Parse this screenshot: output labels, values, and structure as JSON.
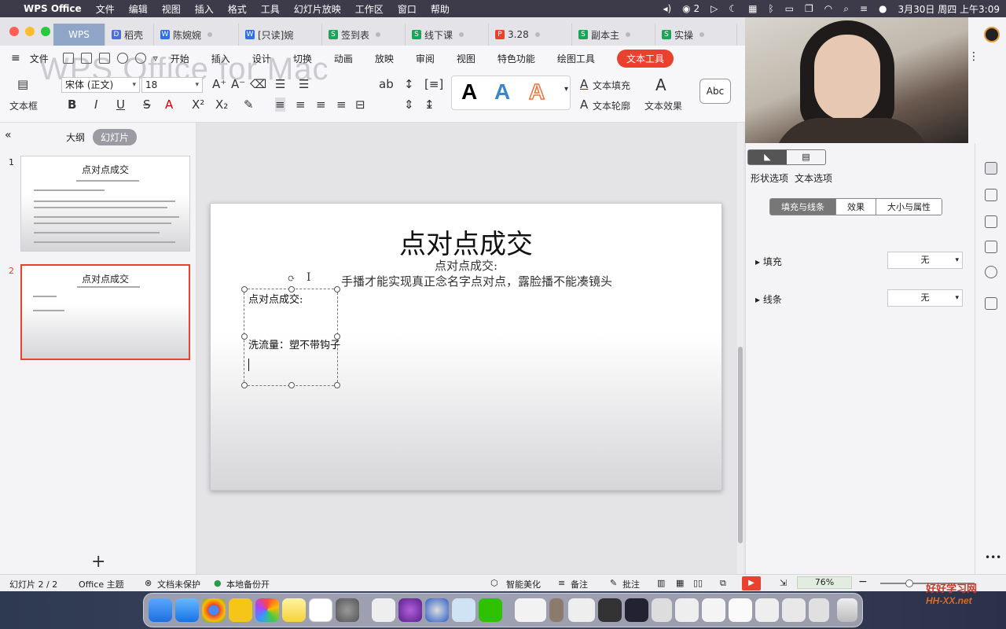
{
  "menubar": {
    "app": "WPS Office",
    "items": [
      "文件",
      "编辑",
      "视图",
      "插入",
      "格式",
      "工具",
      "幻灯片放映",
      "工作区",
      "窗口",
      "帮助"
    ],
    "wechat_badge": "2",
    "clock": "3月30日 周四 上午3:09"
  },
  "tabs": [
    {
      "label": "WPS",
      "color": "#8fa6c8"
    },
    {
      "label": "稻壳",
      "color": "#4a6fd6",
      "icon": "D"
    },
    {
      "label": "陈婉婉",
      "color": "#2f6fe6",
      "icon": "W"
    },
    {
      "label": "[只读]婉",
      "color": "#2f6fe6",
      "icon": "W"
    },
    {
      "label": "签到表",
      "color": "#1fa35a",
      "icon": "S"
    },
    {
      "label": "线下课",
      "color": "#1fa35a",
      "icon": "S"
    },
    {
      "label": "3.28",
      "color": "#e8412e",
      "icon": "P"
    },
    {
      "label": "副本主",
      "color": "#1fa35a",
      "icon": "S"
    },
    {
      "label": "实操",
      "color": "#1fa35a",
      "icon": "S"
    }
  ],
  "ribbon": {
    "file": "文件",
    "watermark": "WPS Office for Mac",
    "menus": [
      "开始",
      "插入",
      "设计",
      "切换",
      "动画",
      "放映",
      "审阅",
      "视图",
      "特色功能",
      "绘图工具"
    ],
    "active_menu": "文本工具",
    "textbox_label": "文本框",
    "font_name": "宋体 (正文)",
    "font_size": "18",
    "text_fill": "文本填充",
    "text_outline": "文本轮廓",
    "text_effect": "文本效果",
    "style_glyph": "A",
    "abc": "Abc"
  },
  "leftpanel": {
    "tab_outline": "大纲",
    "tab_slides": "幻灯片",
    "slides": [
      {
        "num": "1",
        "title": "点对点成交"
      },
      {
        "num": "2",
        "title": "点对点成交"
      }
    ],
    "add": "+"
  },
  "slide": {
    "title": "点对点成交",
    "subtitle1": "点对点成交:",
    "subtitle2": "手播才能实现真正念名字点对点，露脸播不能凑镜头",
    "textbox_line1": "点对点成交:",
    "textbox_line2": "洗流量：塑不带钩子"
  },
  "rightpanel": {
    "shape_options": "形状选项",
    "text_options": "文本选项",
    "subtabs": [
      "填充与线条",
      "效果",
      "大小与属性"
    ],
    "fill_label": "填充",
    "fill_value": "无",
    "line_label": "线条",
    "line_value": "无"
  },
  "statusbar": {
    "slide_index": "幻灯片 2 / 2",
    "theme": "Office 主题",
    "protect": "文档未保护",
    "backup": "本地备份开",
    "beautify": "智能美化",
    "notes": "备注",
    "comment": "批注",
    "zoom": "76%"
  },
  "watermark2": {
    "cn": "好好学习网",
    "url": "HH-XX.net"
  }
}
